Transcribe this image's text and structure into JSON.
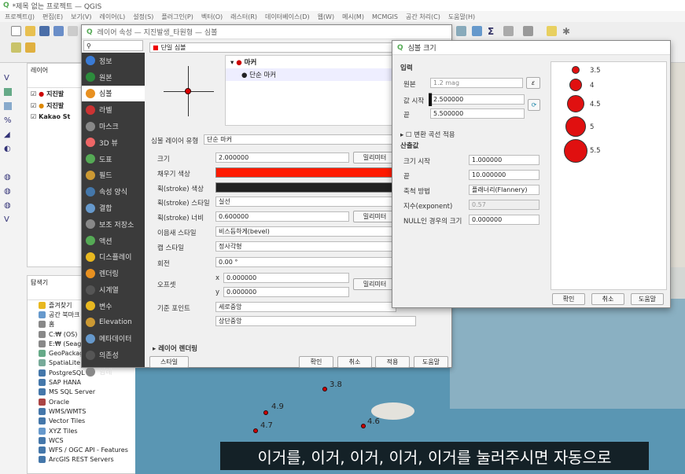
{
  "window": {
    "title": "*제목 없는 프로젝트 — QGIS"
  },
  "menu": [
    "프로젝트(J)",
    "편집(E)",
    "보기(V)",
    "레이어(L)",
    "설정(S)",
    "플러그인(P)",
    "벡터(O)",
    "래스터(R)",
    "데이터베이스(D)",
    "웹(W)",
    "메시(M)",
    "MCMGIS",
    "공간 처리(C)",
    "도움말(H)"
  ],
  "layers_panel": {
    "title": "레이어",
    "items": [
      "지진발",
      "지진발",
      "Kakao St"
    ]
  },
  "browser_panel": {
    "title": "탐색기",
    "items": [
      "즐겨찾기",
      "공간 북마크",
      "홈",
      "C:₩ (OS)",
      "E:₩ (Seaga",
      "GeoPackag",
      "SpatiaLite",
      "PostgreSQL",
      "SAP HANA",
      "MS SQL Server",
      "Oracle",
      "WMS/WMTS",
      "Vector Tiles",
      "XYZ Tiles",
      "WCS",
      "WFS / OGC API - Features",
      "ArcGIS REST Servers"
    ]
  },
  "layer_props": {
    "title": "레이어 속성 — 지진발생_타원형 — 심볼",
    "sidebar": [
      "정보",
      "원본",
      "심볼",
      "라벨",
      "마스크",
      "3D 뷰",
      "도표",
      "필드",
      "속성 양식",
      "결합",
      "보조 저장소",
      "액션",
      "디스플레이",
      "렌더링",
      "시계열",
      "변수",
      "Elevation",
      "메타데이터",
      "의존성",
      "범례"
    ],
    "renderer": "단일 심볼",
    "tree_marker": "마커",
    "tree_simple": "단순 마커",
    "symbol_layer_type_label": "심볼 레이어 유형",
    "symbol_layer_type": "단순 마커",
    "fields": [
      {
        "label": "크기",
        "value": "2.000000"
      },
      {
        "label": "채우기 색상",
        "value": ""
      },
      {
        "label": "획(stroke) 색상",
        "value": ""
      },
      {
        "label": "획(stroke) 스타일",
        "value": "실선"
      },
      {
        "label": "획(stroke) 너비",
        "value": "0.600000"
      },
      {
        "label": "이음새 스타일",
        "value": "비스듬하게(bevel)"
      },
      {
        "label": "캡 스타일",
        "value": "정사각형"
      },
      {
        "label": "회전",
        "value": "0.00 °"
      },
      {
        "label": "오프셋",
        "value": ""
      },
      {
        "label": "기준 포인트",
        "value": "세로중앙"
      }
    ],
    "unit_label": "밀리미터",
    "offset_x": "0.000000",
    "offset_y": "0.000000",
    "anchor_h": "상단중앙",
    "layer_render": "레이어 렌더링",
    "style_btn": "스타일",
    "buttons": [
      "확인",
      "취소",
      "적용",
      "도움말"
    ]
  },
  "size_dialog": {
    "title": "심볼 크기",
    "input_section": "입력",
    "source_label": "원본",
    "source_value": "1.2 mag",
    "val_from_label": "값 시작",
    "val_from": "2.500000",
    "val_to_label": "끝",
    "val_to": "5.500000",
    "transform_curve": "변환 곡선 적용",
    "output_section": "산출값",
    "size_from_label": "크기 시작",
    "size_from": "1.000000",
    "size_to_label": "끝",
    "size_to": "10.000000",
    "method_label": "축척 방법",
    "method": "플래너리(Flannery)",
    "exponent_label": "지수(exponent)",
    "exponent": "0.57",
    "null_label": "NULL인 경우의 크기",
    "null_value": "0.000000",
    "legend": [
      "3.5",
      "4",
      "4.5",
      "5",
      "5.5"
    ],
    "buttons": [
      "확인",
      "취소",
      "도움말"
    ]
  },
  "map_labels": [
    "3.8",
    "4.9",
    "4.7",
    "4.6"
  ],
  "caption": "이거를, 이거, 이거, 이거, 이거를 눌러주시면 자동으로",
  "colors": {
    "fill": "#ff1a00",
    "stroke": "#222222",
    "map_water": "#5a96b3",
    "accent": "#e01010"
  }
}
